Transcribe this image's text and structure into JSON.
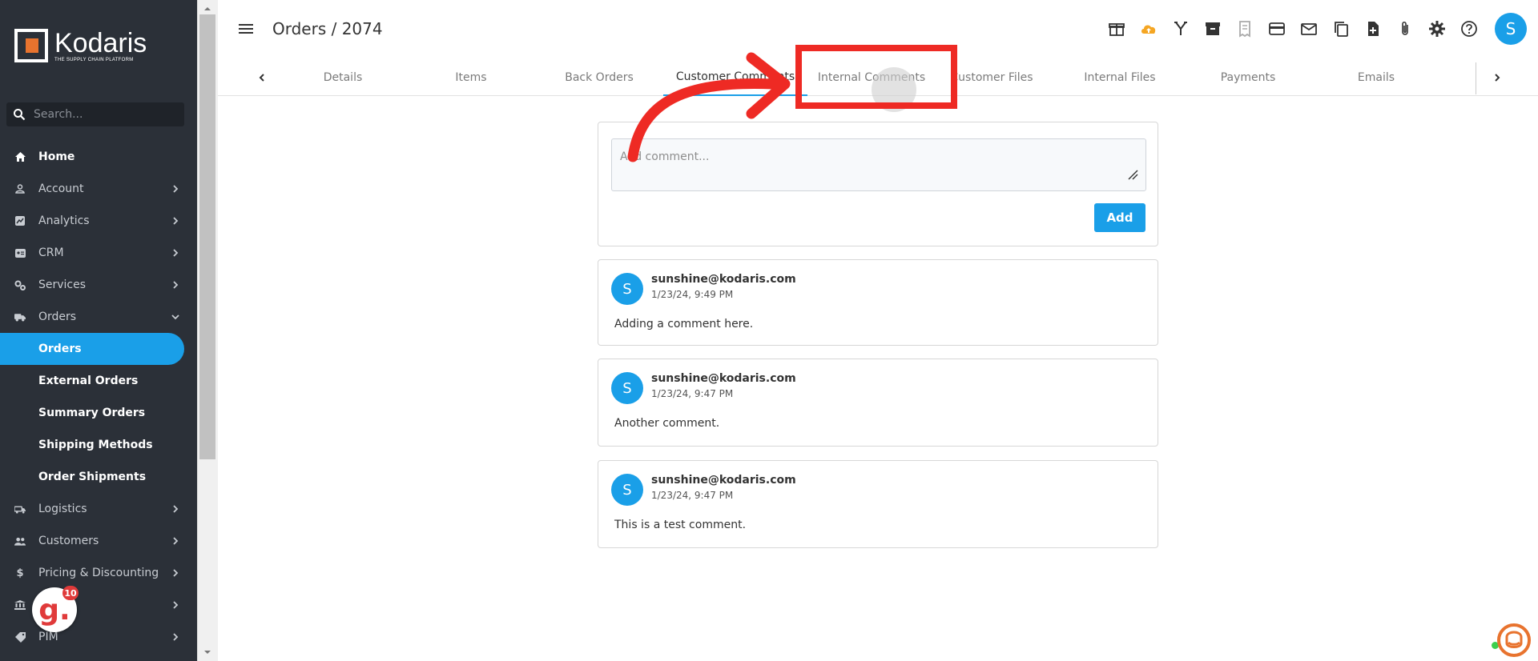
{
  "sidebar": {
    "logo": {
      "name": "Kodaris",
      "tagline": "THE SUPPLY CHAIN PLATFORM"
    },
    "search": {
      "placeholder": "Search..."
    },
    "items": [
      {
        "label": "Home",
        "icon": "home-icon"
      },
      {
        "label": "Account",
        "icon": "account-icon"
      },
      {
        "label": "Analytics",
        "icon": "analytics-icon"
      },
      {
        "label": "CRM",
        "icon": "crm-icon"
      },
      {
        "label": "Services",
        "icon": "services-icon"
      },
      {
        "label": "Orders",
        "icon": "truck-icon"
      },
      {
        "label": "Logistics",
        "icon": "logistics-icon"
      },
      {
        "label": "Customers",
        "icon": "customers-icon"
      },
      {
        "label": "Pricing & Discounting",
        "icon": "dollar-icon"
      },
      {
        "label": "",
        "icon": "bank-icon"
      },
      {
        "label": "PIM",
        "icon": "tag-icon"
      }
    ],
    "orders_sub": [
      {
        "label": "Orders"
      },
      {
        "label": "External Orders"
      },
      {
        "label": "Summary Orders"
      },
      {
        "label": "Shipping Methods"
      },
      {
        "label": "Order Shipments"
      }
    ]
  },
  "header": {
    "title": "Orders / 2074",
    "avatar_initial": "S"
  },
  "tabs": [
    {
      "label": "Details"
    },
    {
      "label": "Items"
    },
    {
      "label": "Back Orders"
    },
    {
      "label": "Customer Comments"
    },
    {
      "label": "Internal Comments"
    },
    {
      "label": "Customer Files"
    },
    {
      "label": "Internal Files"
    },
    {
      "label": "Payments"
    },
    {
      "label": "Emails"
    }
  ],
  "comment_form": {
    "placeholder": "Add comment...",
    "add_label": "Add"
  },
  "comments": [
    {
      "initial": "S",
      "author": "sunshine@kodaris.com",
      "time": "1/23/24, 9:49 PM",
      "body": "Adding a comment here."
    },
    {
      "initial": "S",
      "author": "sunshine@kodaris.com",
      "time": "1/23/24, 9:47 PM",
      "body": "Another comment."
    },
    {
      "initial": "S",
      "author": "sunshine@kodaris.com",
      "time": "1/23/24, 9:47 PM",
      "body": "This is a test comment."
    }
  ],
  "widgets": {
    "badge_letter": "g.",
    "badge_count": "10"
  },
  "colors": {
    "accent": "#1a9fe8",
    "sidebar_bg": "#2b3038",
    "annotation_red": "#ee2a24",
    "logo_orange": "#e8732e"
  }
}
